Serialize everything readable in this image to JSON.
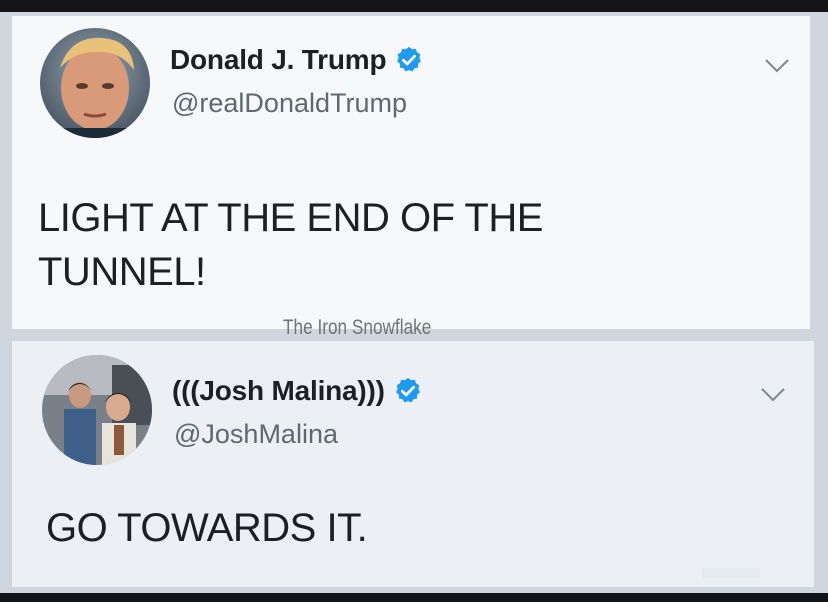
{
  "tweets": [
    {
      "display_name": "Donald J. Trump",
      "handle": "@realDonaldTrump",
      "verified": true,
      "text": "LIGHT AT THE END OF THE\nTUNNEL!"
    },
    {
      "display_name": "(((Josh Malina)))",
      "handle": "@JoshMalina",
      "verified": true,
      "text": "GO TOWARDS IT."
    }
  ],
  "watermark": "The Iron Snowflake",
  "colors": {
    "verified_badge": "#1d9bf0",
    "text_primary": "#1c1f23",
    "text_secondary": "#5e6870",
    "card_background": "#f7f8fa"
  },
  "icons": {
    "verified": "verified-badge-icon",
    "menu": "chevron-down-icon"
  }
}
